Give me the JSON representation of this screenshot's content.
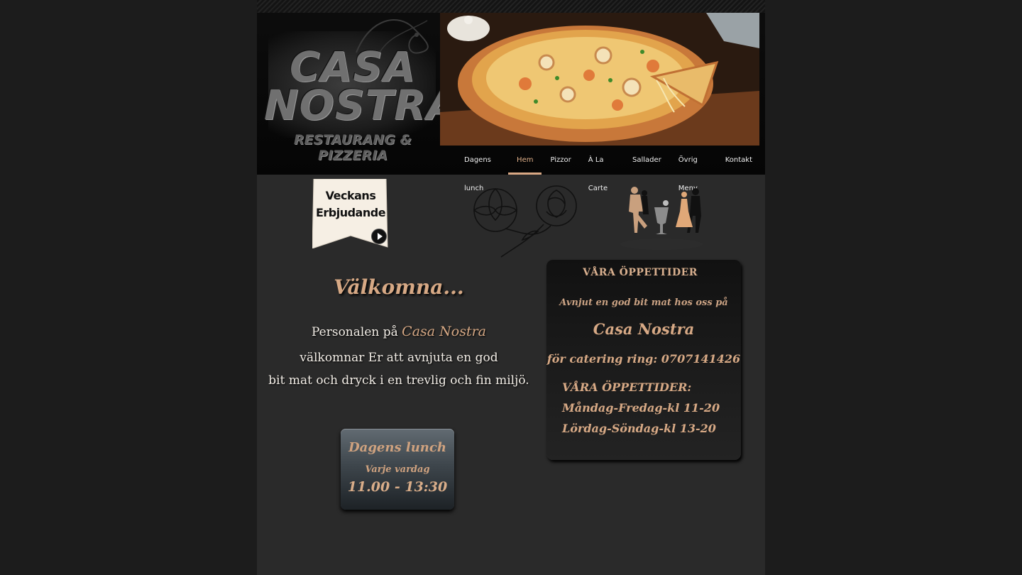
{
  "logo": {
    "line1": "CASA",
    "line2": "NOSTRA",
    "subtitle": "RESTAURANG & PIZZERIA"
  },
  "nav": {
    "items": [
      {
        "label": "Dagens lunch",
        "active": false
      },
      {
        "label": "Hem",
        "active": true
      },
      {
        "label": "Pizzor",
        "active": false
      },
      {
        "label": "À La Carte",
        "active": false
      },
      {
        "label": "Sallader",
        "active": false
      },
      {
        "label": "Övrig Meny",
        "active": false
      },
      {
        "label": "Kontakt",
        "active": false
      }
    ]
  },
  "offer": {
    "line1": "Veckans",
    "line2": "Erbjudande"
  },
  "welcome": {
    "title": "Välkomna...",
    "line1_prefix": "Personalen på",
    "brand": "Casa Nostra",
    "line2": "välkomnar Er att avnjuta en god",
    "line3": "bit mat och dryck i en trevlig och fin miljö."
  },
  "lunch": {
    "title": "Dagens lunch",
    "subtitle": "Varje vardag",
    "time": "11.00 - 13:30"
  },
  "hours": {
    "title": "VÅRA ÖPPETTIDER",
    "intro": "Avnjut en god bit mat hos oss på",
    "brand": "Casa Nostra",
    "catering": "för catering ring: 0707141426",
    "heading": "VÅRA ÖPPETTIDER:",
    "weekdays": "Måndag-Fredag-kl 11-20",
    "weekend": "Lördag-Söndag-kl 13-20"
  },
  "colors": {
    "accent": "#d7a985",
    "page_bg": "#2a2a2a",
    "outer_bg": "#1c1c1c"
  }
}
